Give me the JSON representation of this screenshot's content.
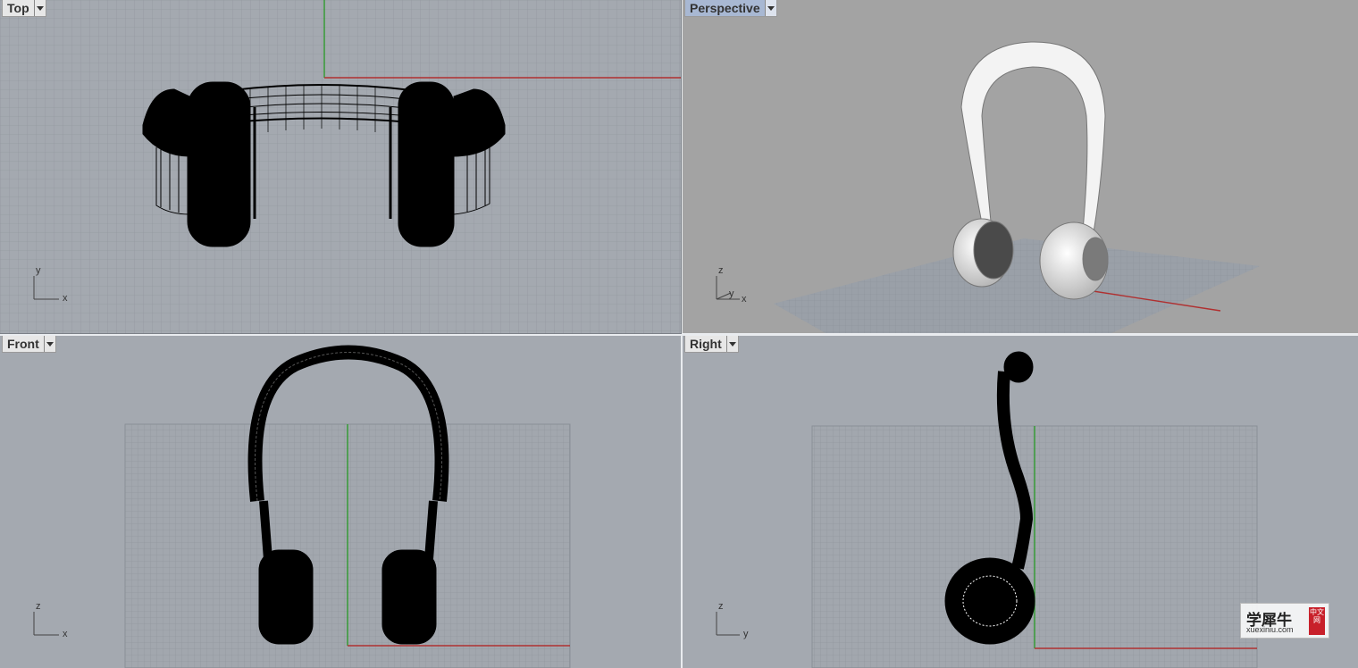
{
  "viewports": {
    "top": {
      "label": "Top",
      "axes": {
        "a": "y",
        "b": "x"
      }
    },
    "perspective": {
      "label": "Perspective",
      "active": true,
      "axes": {
        "a": "z",
        "b": "y",
        "c": "x"
      }
    },
    "front": {
      "label": "Front",
      "axes": {
        "a": "z",
        "b": "x"
      }
    },
    "right": {
      "label": "Right",
      "axes": {
        "a": "z",
        "b": "y"
      }
    }
  },
  "watermark": {
    "chinese": "学犀牛",
    "url": "xuexiniu.com",
    "seal": "中文网"
  },
  "colors": {
    "viewport_bg": "#a4a9b0",
    "perspective_bg": "#a3a3a3",
    "x_axis": "#b03030",
    "y_axis": "#2f9a2f",
    "active_tab": "#a8b8d3"
  },
  "icons": {
    "dropdown": "triangle-down-icon"
  }
}
